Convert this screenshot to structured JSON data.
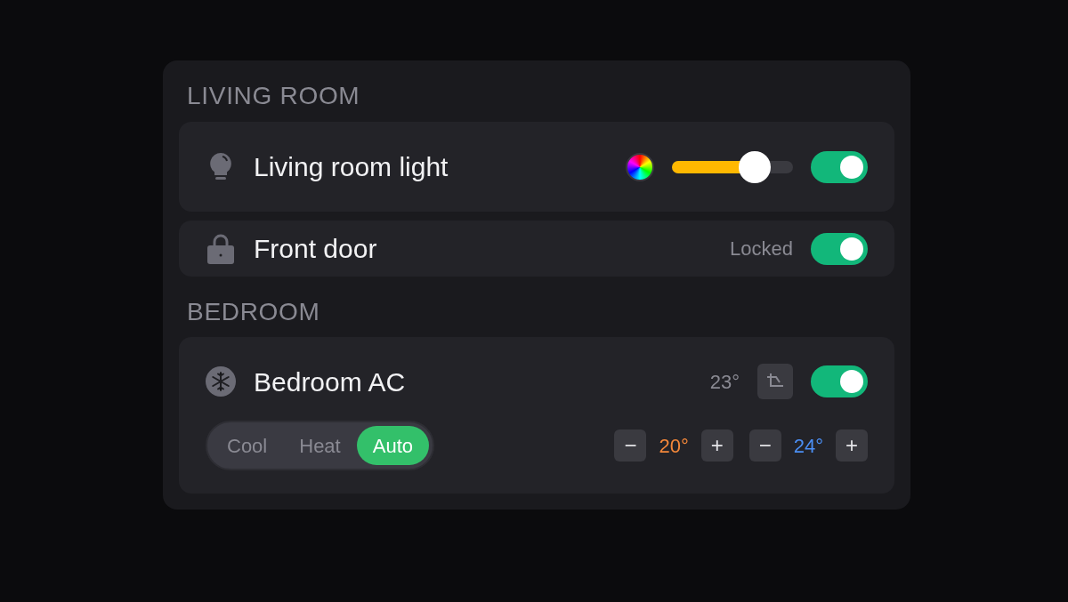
{
  "sections": [
    {
      "title": "LIVING ROOM",
      "devices": [
        {
          "kind": "light",
          "name": "Living room light",
          "level": 0.75,
          "on": true
        },
        {
          "kind": "lock",
          "name": "Front door",
          "status": "Locked",
          "on": true
        }
      ]
    },
    {
      "title": "BEDROOM",
      "devices": [
        {
          "kind": "ac",
          "name": "Bedroom AC",
          "temperature": "23°",
          "on": true,
          "modes": [
            {
              "label": "Cool",
              "selected": false
            },
            {
              "label": "Heat",
              "selected": false
            },
            {
              "label": "Auto",
              "selected": true
            }
          ],
          "setpoints": [
            {
              "minus": "−",
              "value": "20°",
              "plus": "+",
              "color": "#f5883a"
            },
            {
              "minus": "−",
              "value": "24°",
              "plus": "+",
              "color": "#4b8ff5"
            }
          ]
        }
      ]
    }
  ]
}
